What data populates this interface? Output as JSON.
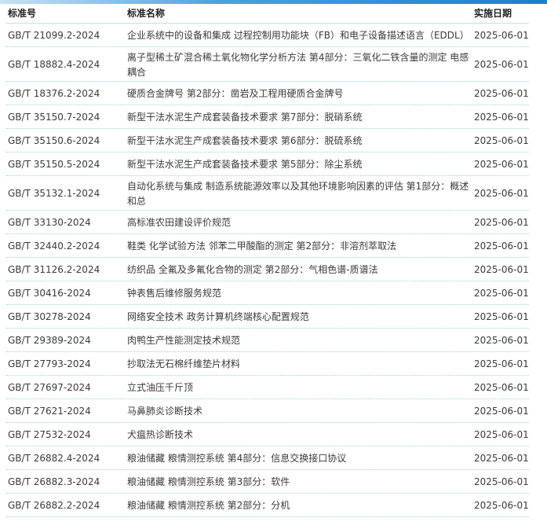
{
  "table": {
    "headers": {
      "code": "标准号",
      "name": "标准名称",
      "date": "实施日期"
    },
    "rows": [
      {
        "code": "GB/T 21099.2-2024",
        "name": "企业系统中的设备和集成 过程控制用功能块（FB）和电子设备描述语言（EDDL）",
        "date": "2025-06-01"
      },
      {
        "code": "GB/T 18882.4-2024",
        "name": "离子型稀土矿混合稀土氧化物化学分析方法 第4部分：三氧化二铁含量的测定 电感耦合",
        "date": "2025-06-01"
      },
      {
        "code": "GB/T 18376.2-2024",
        "name": "硬质合金牌号 第2部分：凿岩及工程用硬质合金牌号",
        "date": "2025-06-01"
      },
      {
        "code": "GB/T 35150.7-2024",
        "name": "新型干法水泥生产成套装备技术要求 第7部分：脱硝系统",
        "date": "2025-06-01"
      },
      {
        "code": "GB/T 35150.6-2024",
        "name": "新型干法水泥生产成套装备技术要求 第6部分：脱硫系统",
        "date": "2025-06-01"
      },
      {
        "code": "GB/T 35150.5-2024",
        "name": "新型干法水泥生产成套装备技术要求 第5部分：除尘系统",
        "date": "2025-06-01"
      },
      {
        "code": "GB/T 35132.1-2024",
        "name": "自动化系统与集成 制造系统能源效率以及其他环境影响因素的评估 第1部分：概述和总",
        "date": "2025-06-01"
      },
      {
        "code": "GB/T 33130-2024",
        "name": "高标准农田建设评价规范",
        "date": "2025-06-01"
      },
      {
        "code": "GB/T 32440.2-2024",
        "name": "鞋类 化学试验方法 邻苯二甲酸酯的测定 第2部分：非溶剂萃取法",
        "date": "2025-06-01"
      },
      {
        "code": "GB/T 31126.2-2024",
        "name": "纺织品 全氟及多氟化合物的测定 第2部分：气相色谱-质谱法",
        "date": "2025-06-01"
      },
      {
        "code": "GB/T 30416-2024",
        "name": "钟表售后维修服务规范",
        "date": "2025-06-01"
      },
      {
        "code": "GB/T 30278-2024",
        "name": "网络安全技术 政务计算机终端核心配置规范",
        "date": "2025-06-01"
      },
      {
        "code": "GB/T 29389-2024",
        "name": "肉鸭生产性能测定技术规范",
        "date": "2025-06-01"
      },
      {
        "code": "GB/T 27793-2024",
        "name": "抄取法无石棉纤维垫片材料",
        "date": "2025-06-01"
      },
      {
        "code": "GB/T 27697-2024",
        "name": "立式油压千斤顶",
        "date": "2025-06-01"
      },
      {
        "code": "GB/T 27621-2024",
        "name": "马鼻肺炎诊断技术",
        "date": "2025-06-01"
      },
      {
        "code": "GB/T 27532-2024",
        "name": "犬瘟热诊断技术",
        "date": "2025-06-01"
      },
      {
        "code": "GB/T 26882.4-2024",
        "name": "粮油储藏 粮情测控系统 第4部分：信息交换接口协议",
        "date": "2025-06-01"
      },
      {
        "code": "GB/T 26882.3-2024",
        "name": "粮油储藏 粮情测控系统 第3部分：软件",
        "date": "2025-06-01"
      },
      {
        "code": "GB/T 26882.2-2024",
        "name": "粮油储藏 粮情测控系统 第2部分：分机",
        "date": "2025-06-01"
      }
    ]
  }
}
